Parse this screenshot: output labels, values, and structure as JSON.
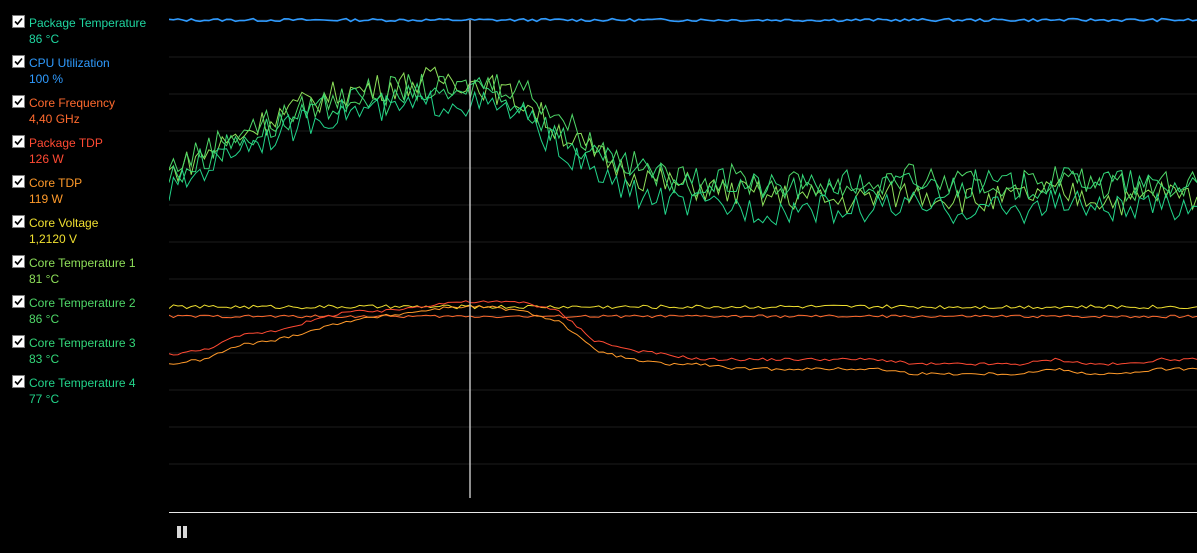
{
  "legend": {
    "items": [
      {
        "name": "Package Temperature",
        "value": "86 °C",
        "color": "#1fd6a0",
        "checked": true
      },
      {
        "name": "CPU Utilization",
        "value": "100 %",
        "color": "#2f9bff",
        "checked": true
      },
      {
        "name": "Core Frequency",
        "value": "4,40 GHz",
        "color": "#ff6a2e",
        "checked": true
      },
      {
        "name": "Package TDP",
        "value": "126 W",
        "color": "#ff4a33",
        "checked": true
      },
      {
        "name": "Core TDP",
        "value": "119 W",
        "color": "#ff9a2a",
        "checked": true
      },
      {
        "name": "Core Voltage",
        "value": "1,2120 V",
        "color": "#f0e030",
        "checked": true
      },
      {
        "name": "Core Temperature 1",
        "value": "81 °C",
        "color": "#8ee05a",
        "checked": true
      },
      {
        "name": "Core Temperature 2",
        "value": "86 °C",
        "color": "#4fd868",
        "checked": true
      },
      {
        "name": "Core Temperature 3",
        "value": "83 °C",
        "color": "#33d87a",
        "checked": true
      },
      {
        "name": "Core Temperature 4",
        "value": "77 °C",
        "color": "#22d48a",
        "checked": true
      }
    ]
  },
  "controls": {
    "pause_icon": "pause-icon"
  },
  "chart_data": {
    "type": "line",
    "grid": true,
    "cursor_line": true,
    "ylim": [
      0,
      100
    ],
    "series": [
      {
        "name": "CPU Utilization",
        "color": "#2f9bff",
        "values": [
          100,
          100,
          100,
          100,
          100,
          100,
          100,
          100,
          100,
          100,
          100,
          100,
          100,
          100,
          100,
          100,
          100,
          100,
          100,
          100,
          100,
          100,
          100,
          100,
          100,
          100,
          100,
          100,
          100,
          100
        ]
      },
      {
        "name": "Core Temperature 1",
        "color": "#8ee05a",
        "values": [
          68,
          72,
          76,
          80,
          83,
          85,
          86,
          87,
          88,
          86,
          83,
          77,
          72,
          68,
          66,
          65,
          64,
          63,
          63,
          62,
          63,
          64,
          63,
          62,
          63,
          64,
          63,
          62,
          64,
          63
        ]
      },
      {
        "name": "Core Temperature 2",
        "color": "#4fd868",
        "values": [
          69,
          73,
          77,
          79,
          82,
          84,
          85,
          86,
          85,
          87,
          86,
          80,
          74,
          70,
          67,
          66,
          67,
          65,
          66,
          65,
          66,
          67,
          66,
          65,
          66,
          67,
          66,
          65,
          66,
          66
        ]
      },
      {
        "name": "Core Temperature 3",
        "color": "#33d87a",
        "values": [
          67,
          71,
          75,
          78,
          80,
          83,
          83,
          84,
          85,
          85,
          82,
          76,
          71,
          69,
          67,
          66,
          66,
          65,
          65,
          66,
          65,
          66,
          65,
          66,
          65,
          66,
          67,
          66,
          65,
          66
        ]
      },
      {
        "name": "Core Temperature 4",
        "color": "#22d48a",
        "values": [
          64,
          69,
          74,
          76,
          79,
          81,
          81,
          82,
          83,
          82,
          80,
          73,
          68,
          64,
          62,
          61,
          61,
          60,
          61,
          60,
          61,
          61,
          60,
          61,
          60,
          62,
          61,
          60,
          61,
          61
        ]
      },
      {
        "name": "Core Voltage",
        "color": "#f0e030",
        "values": [
          40,
          40,
          40,
          40,
          40,
          40,
          40,
          40,
          40,
          40,
          40,
          40,
          40,
          40,
          40,
          40,
          40,
          40,
          40,
          40,
          40,
          40,
          40,
          40,
          40,
          40,
          40,
          40,
          40,
          40
        ]
      },
      {
        "name": "Core Frequency",
        "color": "#ff6a2e",
        "values": [
          38,
          38,
          38,
          38,
          38,
          38,
          38,
          38,
          38,
          38,
          38,
          38,
          38,
          38,
          38,
          38,
          38,
          38,
          38,
          38,
          38,
          38,
          38,
          38,
          38,
          38,
          38,
          38,
          38,
          38
        ]
      },
      {
        "name": "Package TDP",
        "color": "#ff4a33",
        "values": [
          30,
          31,
          34,
          35,
          37,
          39,
          39,
          40,
          41,
          41,
          41,
          39,
          33,
          31,
          30,
          29,
          29,
          29,
          29,
          29,
          29,
          28,
          28,
          28,
          28,
          29,
          28,
          28,
          29,
          29
        ]
      },
      {
        "name": "Core TDP",
        "color": "#ff9a2a",
        "values": [
          28,
          29,
          32,
          33,
          35,
          37,
          38,
          39,
          40,
          40,
          39,
          37,
          31,
          29,
          28,
          28,
          27,
          27,
          27,
          27,
          27,
          26,
          26,
          26,
          26,
          27,
          26,
          26,
          27,
          27
        ]
      }
    ]
  }
}
